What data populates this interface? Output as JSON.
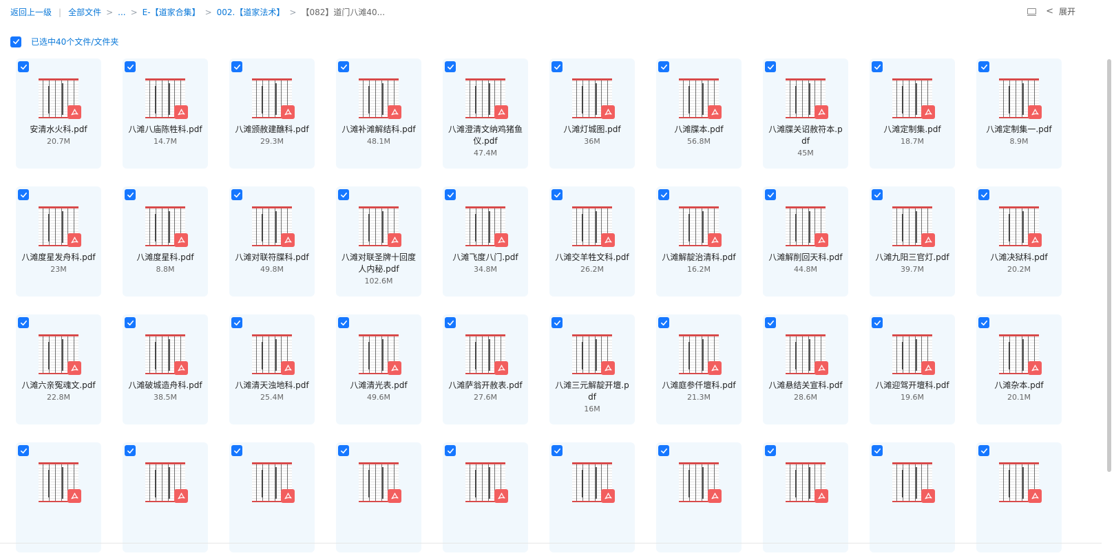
{
  "header": {
    "back_label": "返回上一级",
    "crumb_all": "全部文件",
    "crumb_ellipsis": "...",
    "crumb_e": "E-【道家合集】",
    "crumb_002": "002.【道家法术】",
    "crumb_current": "【082】道门八滩40...",
    "expand_label": "展开",
    "chev_glyph": "<"
  },
  "selection": {
    "label": "已选中40个文件/文件夹"
  },
  "files": [
    {
      "name": "安清水火科.pdf",
      "size": "20.7M"
    },
    {
      "name": "八滩八庙陈牲科.pdf",
      "size": "14.7M"
    },
    {
      "name": "八滩颁赦建醮科.pdf",
      "size": "29.3M"
    },
    {
      "name": "八滩补滩解结科.pdf",
      "size": "48.1M"
    },
    {
      "name": "八滩澄清文纳鸡猪鱼仪.pdf",
      "size": "47.4M"
    },
    {
      "name": "八滩灯城图.pdf",
      "size": "36M"
    },
    {
      "name": "八滩牒本.pdf",
      "size": "56.8M"
    },
    {
      "name": "八滩牒关诏赦符本.pdf",
      "size": "45M"
    },
    {
      "name": "八滩定制集.pdf",
      "size": "18.7M"
    },
    {
      "name": "八滩定制集一.pdf",
      "size": "8.9M"
    },
    {
      "name": "八滩度星发舟科.pdf",
      "size": "23M"
    },
    {
      "name": "八滩度星科.pdf",
      "size": "8.8M"
    },
    {
      "name": "八滩对联符牒科.pdf",
      "size": "49.8M"
    },
    {
      "name": "八滩对联圣牌十回度人内秘.pdf",
      "size": "102.6M"
    },
    {
      "name": "八滩飞度八门.pdf",
      "size": "34.8M"
    },
    {
      "name": "八滩交羊牲文科.pdf",
      "size": "26.2M"
    },
    {
      "name": "八滩解靛治清科.pdf",
      "size": "16.2M"
    },
    {
      "name": "八滩解削回天科.pdf",
      "size": "44.8M"
    },
    {
      "name": "八滩九阳三官灯.pdf",
      "size": "39.7M"
    },
    {
      "name": "八滩决狱科.pdf",
      "size": "20.2M"
    },
    {
      "name": "八滩六亲冤魂文.pdf",
      "size": "22.8M"
    },
    {
      "name": "八滩破城造舟科.pdf",
      "size": "38.5M"
    },
    {
      "name": "八滩清天浊地科.pdf",
      "size": "25.4M"
    },
    {
      "name": "八滩清光表.pdf",
      "size": "49.6M"
    },
    {
      "name": "八滩萨翁开赦表.pdf",
      "size": "27.6M"
    },
    {
      "name": "八滩三元解靛开壇.pdf",
      "size": "16M"
    },
    {
      "name": "八滩庭参仟壇科.pdf",
      "size": "21.3M"
    },
    {
      "name": "八滩悬结关宣科.pdf",
      "size": "28.6M"
    },
    {
      "name": "八滩迎驾开壇科.pdf",
      "size": "19.6M"
    },
    {
      "name": "八滩杂本.pdf",
      "size": "20.1M"
    },
    {
      "name": "",
      "size": ""
    },
    {
      "name": "",
      "size": ""
    },
    {
      "name": "",
      "size": ""
    },
    {
      "name": "",
      "size": ""
    },
    {
      "name": "",
      "size": ""
    },
    {
      "name": "",
      "size": ""
    },
    {
      "name": "",
      "size": ""
    },
    {
      "name": "",
      "size": ""
    },
    {
      "name": "",
      "size": ""
    },
    {
      "name": "",
      "size": ""
    }
  ],
  "icons": {
    "checkbox": "check-icon",
    "pdf": "pdf-icon",
    "list_view": "list-view-icon"
  },
  "colors": {
    "accent": "#1677ff",
    "link": "#0a78d8",
    "card_bg": "#f1f8fd",
    "pdf_badge": "#f25e5e"
  }
}
